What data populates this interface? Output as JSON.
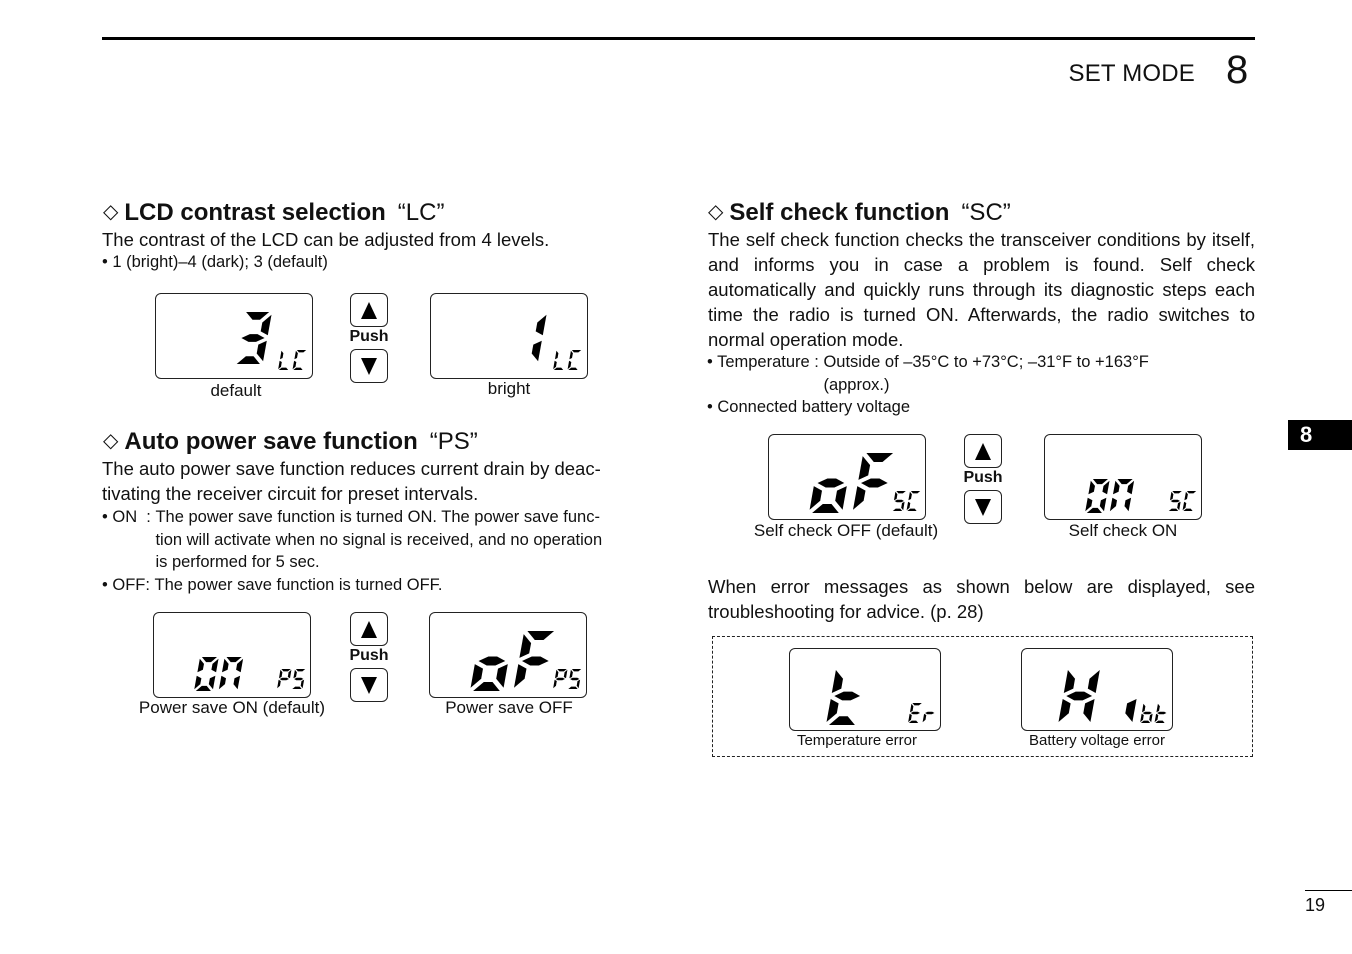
{
  "header": {
    "section_title": "SET MODE",
    "chapter_number": "8"
  },
  "side_tab": {
    "label": "8"
  },
  "page_number": "19",
  "lcd_contrast": {
    "title": "LCD contrast selection",
    "code": "“LC”",
    "description": "The contrast of the LCD can be adjusted from 4 levels.",
    "bullets": [
      "• 1 (bright)–4 (dark); 3 (default)"
    ],
    "displays": [
      {
        "main": "3",
        "sub": "LC",
        "caption": "default"
      },
      {
        "main": "1",
        "sub": "LC",
        "caption": "bright"
      }
    ],
    "push_label": "Push"
  },
  "auto_power_save": {
    "title": "Auto power save function",
    "code": "“PS”",
    "description": "The auto power save function reduces current drain by deactivating the receiver circuit for preset intervals.",
    "description_lines": [
      "The auto power save function reduces current drain by deac-",
      "tivating the receiver circuit for preset intervals."
    ],
    "options": [
      {
        "lead": "• ON  : ",
        "lines": [
          "The power save function is turned ON. The power save func-",
          "tion will activate when no signal is received, and no operation",
          "is performed for 5 sec."
        ]
      },
      {
        "lead": "• OFF: ",
        "lines": [
          "The power save function is turned OFF."
        ]
      }
    ],
    "displays": [
      {
        "main": "On",
        "sub": "PS",
        "caption": "Power save ON (default)"
      },
      {
        "main": "oF",
        "sub": "PS",
        "caption": "Power save OFF"
      }
    ],
    "push_label": "Push"
  },
  "self_check": {
    "title": "Self check function",
    "code": "“SC”",
    "description": "The self check function checks the transceiver conditions by itself, and informs you in case a problem is found. Self check automatically and quickly runs through its diagnostic steps each time the radio is turned ON. Afterwards, the radio switches to normal operation mode.",
    "bullets": [
      {
        "lead": "• Temperature : ",
        "lines": [
          "Outside of –35°C to +73°C; –31°F to +163°F",
          "(approx.)"
        ]
      },
      {
        "lead": "• ",
        "lines": [
          "Connected battery voltage"
        ]
      }
    ],
    "displays": [
      {
        "main": "oF",
        "sub": "SC",
        "caption": "Self check OFF (default)"
      },
      {
        "main": "On",
        "sub": "SC",
        "caption": "Self check ON"
      }
    ],
    "push_label": "Push",
    "error_note": "When error messages as shown below are displayed, see troubleshooting for advice. (p. 28)",
    "errors": [
      {
        "main": "t",
        "sub": "Er",
        "caption": "Temperature error"
      },
      {
        "main": "Hi",
        "sub": "bt",
        "caption": "Battery voltage error"
      }
    ]
  }
}
